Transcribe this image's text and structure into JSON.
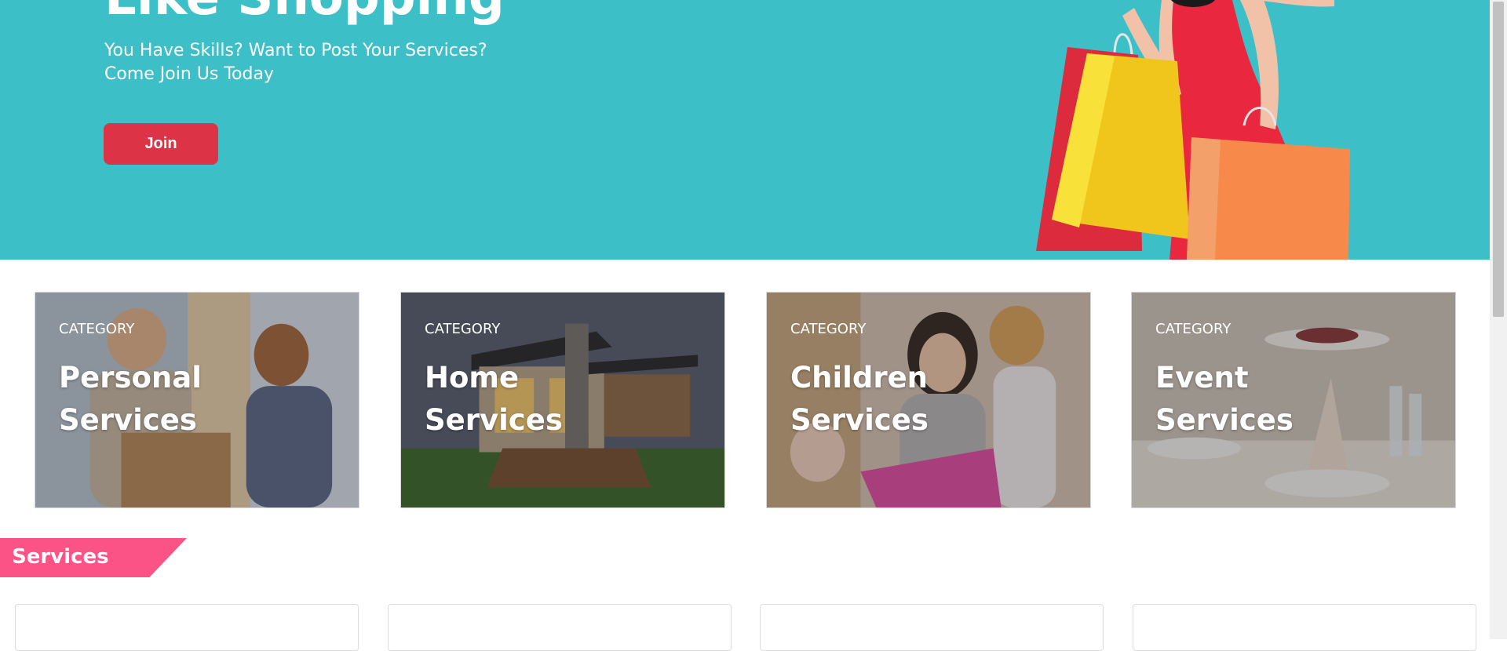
{
  "hero": {
    "title": "Like Shopping",
    "subtitle_line1": "You Have Skills? Want to Post Your Services?",
    "subtitle_line2": "Come Join Us Today",
    "join_label": "Join",
    "background_color": "#3dbfc8",
    "illustration": "woman-with-shopping-bags"
  },
  "categories": [
    {
      "label": "CATEGORY",
      "name_line1": "Personal",
      "name_line2": "Services",
      "image": "delivery-person-photo"
    },
    {
      "label": "CATEGORY",
      "name_line1": "Home",
      "name_line2": "Services",
      "image": "modern-house-photo"
    },
    {
      "label": "CATEGORY",
      "name_line1": "Children",
      "name_line2": "Services",
      "image": "mother-with-children-photo"
    },
    {
      "label": "CATEGORY",
      "name_line1": "Event",
      "name_line2": "Services",
      "image": "banquet-table-photo"
    }
  ],
  "services": {
    "heading": "Services",
    "accent_color": "#fc5386"
  },
  "colors": {
    "join_button": "#dd3347"
  }
}
